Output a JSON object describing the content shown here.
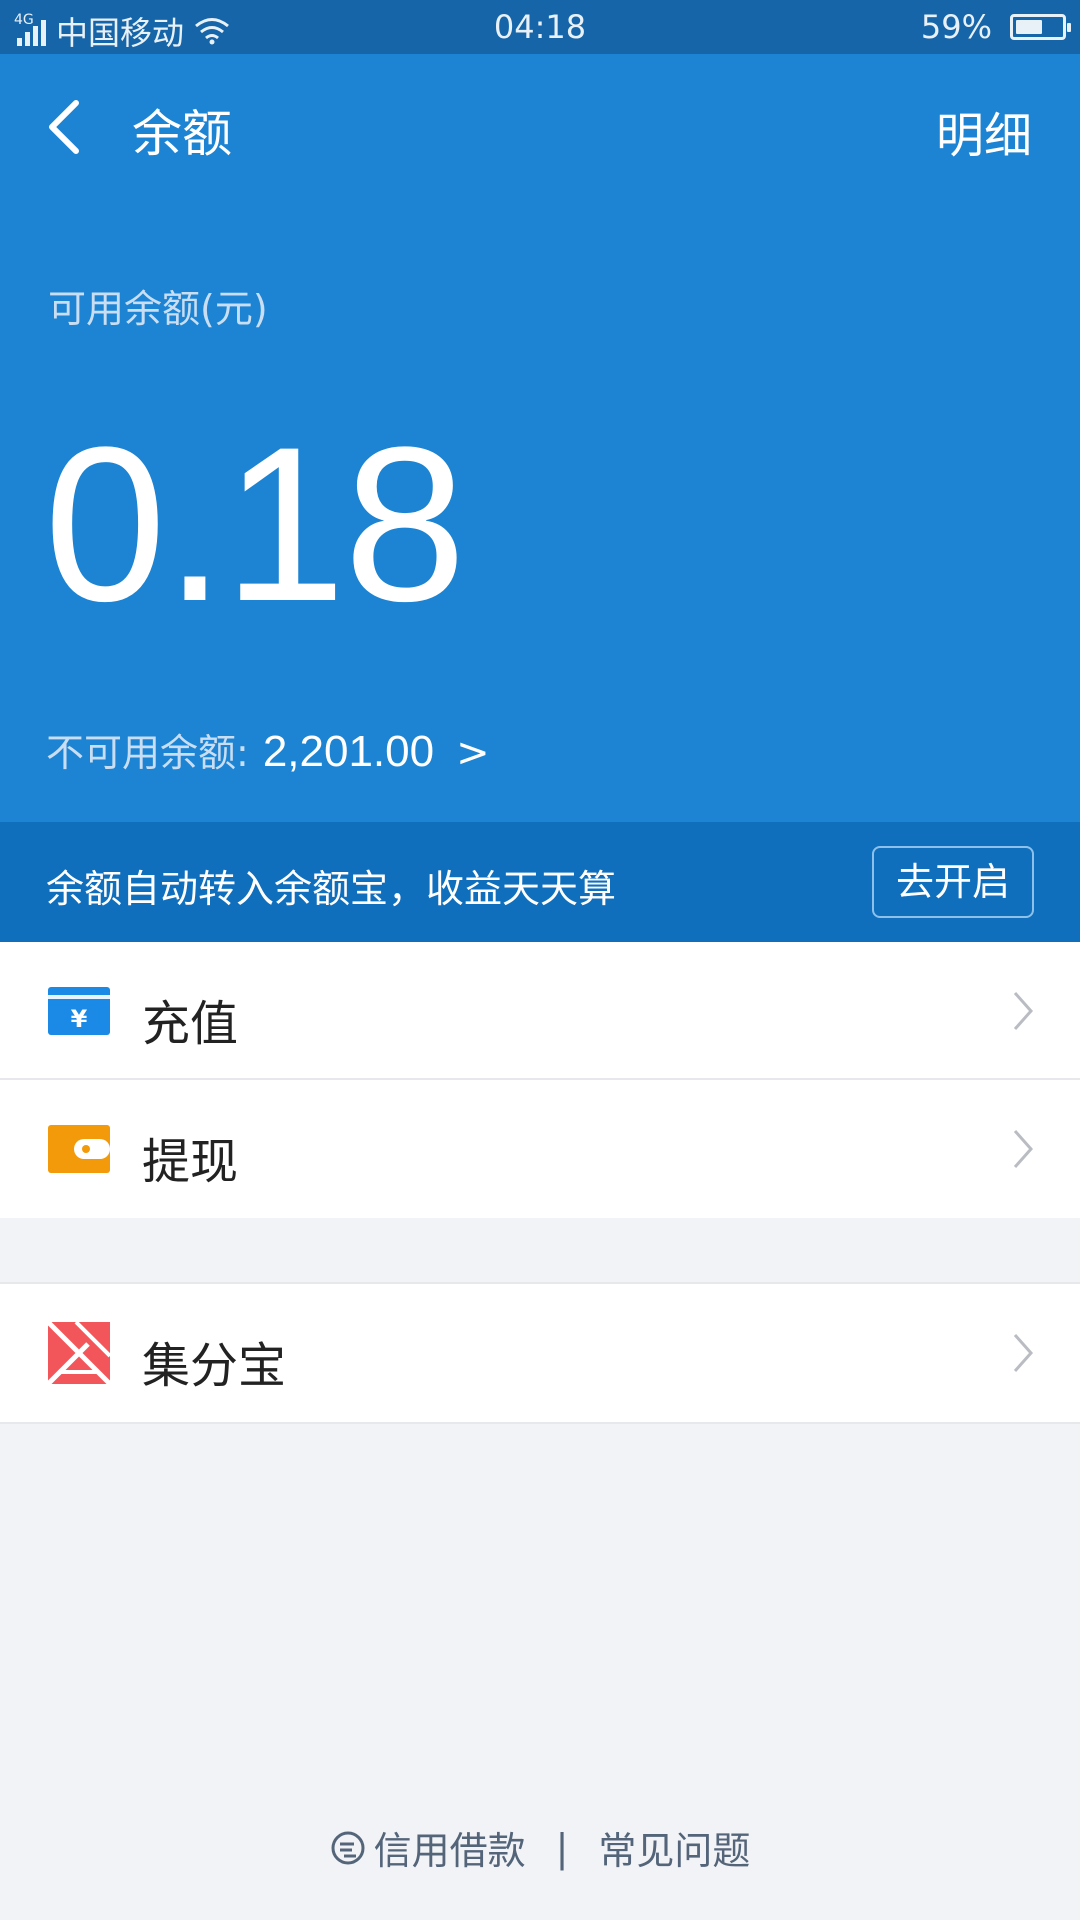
{
  "status_bar": {
    "network": "4G",
    "carrier": "中国移动",
    "time": "04:18",
    "battery": "59%"
  },
  "header": {
    "title": "余额",
    "detail_label": "明细",
    "available_label": "可用余额(元)",
    "available_amount": "0.18",
    "unavailable_label": "不可用余额:",
    "unavailable_amount": "2,201.00",
    "unavailable_chevron": ">"
  },
  "banner": {
    "text": "余额自动转入余额宝，收益天天算",
    "button_label": "去开启"
  },
  "menu": [
    {
      "label": "充值",
      "icon": "recharge-card-icon"
    },
    {
      "label": "提现",
      "icon": "wallet-icon"
    }
  ],
  "menu2": [
    {
      "label": "集分宝",
      "icon": "jifenbao-logo-icon"
    }
  ],
  "footer": {
    "credit_loan": "信用借款",
    "separator": "|",
    "faq": "常见问题"
  },
  "colors": {
    "header_bg": "#1c84d3",
    "banner_bg": "#0f6fbd",
    "recharge_icon": "#1a8ae6",
    "withdraw_icon": "#f39a0a",
    "jifenbao_icon": "#f2555a"
  }
}
